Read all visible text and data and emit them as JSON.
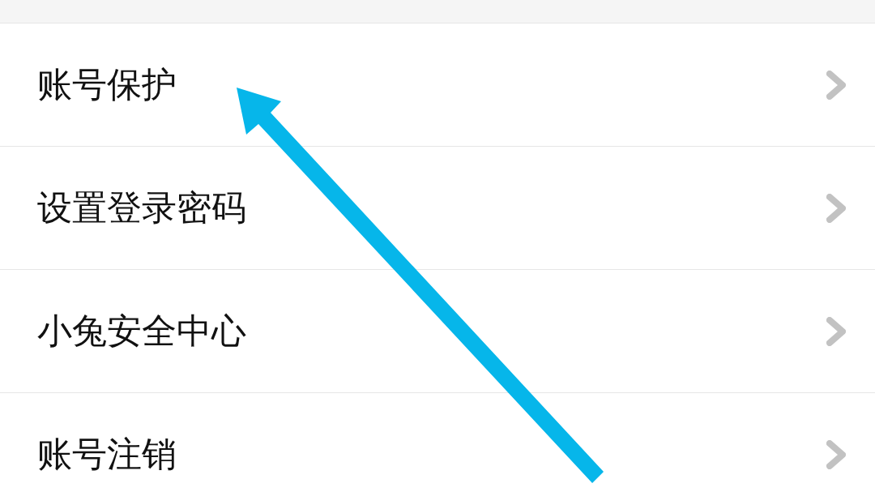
{
  "settings_list": [
    {
      "label": "账号保护"
    },
    {
      "label": "设置登录密码"
    },
    {
      "label": "小兔安全中心"
    },
    {
      "label": "账号注销"
    }
  ]
}
